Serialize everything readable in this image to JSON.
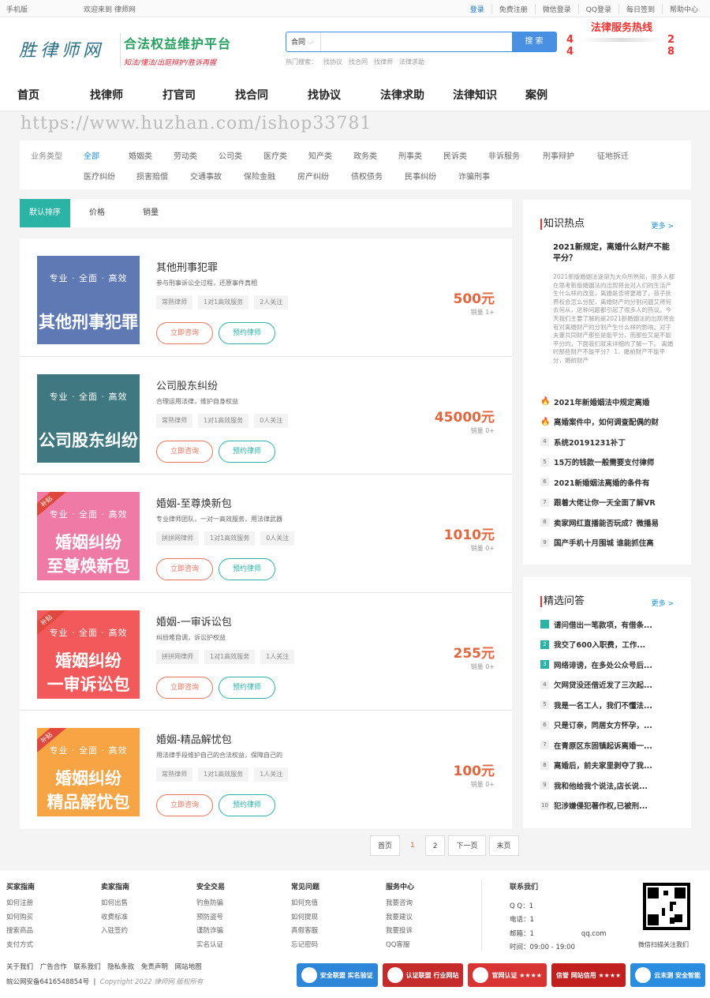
{
  "topbar": {
    "mobile": "手机版",
    "welcome": "欢迎来到 律师网",
    "links": [
      "登录",
      "免费注册",
      "微信登录",
      "QQ登录",
      "每日签到",
      "帮助中心"
    ]
  },
  "header": {
    "logo": "胜律师网",
    "slogan": "合法权益维护平台",
    "slogan_sub": "知法/懂法/出庭辩护/胜诉再握",
    "search": {
      "type": "合同",
      "button": "搜 索",
      "hot_label": "热门搜索：",
      "hot": [
        "找协议",
        "找合同",
        "找律师",
        "法律求助"
      ]
    },
    "hotline": {
      "title": "法律服务热线",
      "line1_left": "4",
      "line1_right": "2",
      "line2_left": "4",
      "line2_right": "8"
    }
  },
  "nav": [
    "首页",
    "找律师",
    "打官司",
    "找合同",
    "找协议",
    "法律求助",
    "法律知识",
    "案例"
  ],
  "watermark": "https://www.huzhan.com/ishop33781",
  "filter": {
    "label": "业务类型",
    "row1": [
      "全部",
      "婚姻类",
      "劳动类",
      "公司类",
      "医疗类",
      "知产类",
      "政务类",
      "刑事类",
      "民诉类",
      "非诉服务",
      "刑事辩护",
      "征地拆迁"
    ],
    "row2": [
      "医疗纠纷",
      "损害赔偿",
      "交通事故",
      "保险金融",
      "房产纠纷",
      "债权债务",
      "民事纠纷",
      "诈骗刑事"
    ]
  },
  "sort": [
    "默认排序",
    "价格",
    "销量"
  ],
  "items": [
    {
      "img_sub": "专业 · 全面 · 高效",
      "img_l1": "其他刑事犯罪",
      "img_l2": "",
      "title": "其他刑事犯罪",
      "desc": "参与刑事诉讼全过程，还原事件真相",
      "tags": [
        "常熟律师",
        "1对1高效服务",
        "2人关注"
      ],
      "price": "500元",
      "sales": "销量 1+",
      "consult": "立即咨询",
      "book": "预约律师",
      "color": "#5e79b4",
      "badge": ""
    },
    {
      "img_sub": "专业 · 全面 · 高效",
      "img_l1": "公司股东纠纷",
      "img_l2": "",
      "title": "公司股东纠纷",
      "desc": "合理运用法律，维护自身权益",
      "tags": [
        "常熟律师",
        "1对1高效服务",
        "0人关注"
      ],
      "price": "45000元",
      "sales": "销量 0+",
      "consult": "立即咨询",
      "book": "预约律师",
      "color": "#3f7880",
      "badge": ""
    },
    {
      "img_sub": "专业 · 全面 · 高效",
      "img_l1": "婚姻纠纷",
      "img_l2": "至尊焕新包",
      "title": "婚姻-至尊焕新包",
      "desc": "专业律师团队，一对一高效服务，用法律武器",
      "tags": [
        "拼拼网律师",
        "1对1高效服务",
        "0人关注"
      ],
      "price": "1010元",
      "sales": "销量 0+",
      "consult": "立即咨询",
      "book": "预约律师",
      "color": "#f07aa6",
      "badge": "补贴"
    },
    {
      "img_sub": "专业 · 全面 · 高效",
      "img_l1": "婚姻纠纷",
      "img_l2": "一审诉讼包",
      "title": "婚姻-一审诉讼包",
      "desc": "纠纷难自调，诉讼护权益",
      "tags": [
        "拼拼网律师",
        "1对1高效服务",
        "1人关注"
      ],
      "price": "255元",
      "sales": "销量 0+",
      "consult": "立即咨询",
      "book": "预约律师",
      "color": "#f2595a",
      "badge": "补贴"
    },
    {
      "img_sub": "专业 · 全面 · 高效",
      "img_l1": "婚姻纠纷",
      "img_l2": "精品解忧包",
      "title": "婚姻-精品解忧包",
      "desc": "用法律手段维护自己的合法权益，保障自己的",
      "tags": [
        "常熟律师",
        "1对1高效服务",
        "1人关注"
      ],
      "price": "100元",
      "sales": "销量 0+",
      "consult": "立即咨询",
      "book": "预约律师",
      "color": "#f7a445",
      "badge": "补贴"
    }
  ],
  "pager": [
    "首页",
    "1",
    "2",
    "下一页",
    "末页"
  ],
  "knowledge": {
    "title": "知识热点",
    "more": "更多 >",
    "top_title": "2021新规定，离婚什么财产不能平分？",
    "top_para": "2021新版婚姻法逐渐为大众所熟知，很多人都在思考新版婚姻法的出现将会对人们的生活产生什么样的改变，离婚是否将更难了，孩子抚养权会怎么分配，离婚财产的分割问题又将何去何从，这种问题都引起了很多人的热议。今天我们主要了解的是2021新婚姻法的出现将会有对离婚财产的分割产生什么样的影响。对于夫妻共同财产那些是能平分，而那些又是不能平分的，下面我们就来详细的了解一下。  离婚时那些财产不能平分？  1、婚前财产不能平分，婚前财产",
    "list": [
      "2021年新婚姻法中规定离婚",
      "离婚案件中，如何调查配偶的财",
      "系统20191231补丁",
      "15万的钱款一般需要支付律师",
      "2021新婚姻法离婚的条件有",
      "跟着大佬让你一天全面了解VR",
      "卖家网红直播能否玩成？微播易",
      "国产手机十月围城 谁能抓住高"
    ],
    "nums": [
      "",
      "",
      "4",
      "5",
      "6",
      "7",
      "8",
      "9"
    ]
  },
  "qa": {
    "title": "精选问答",
    "more": "更多 >",
    "list": [
      "请问借出一笔款项，有借条...",
      "我交了600入职费，工作...",
      "网络诽谤，在多处公众号后...",
      "欠网贷没还借近发了三次起...",
      "我是一名工人，我们不懂法...",
      "只是订亲，同居女方怀孕，...",
      "在青原区东固镇起诉离婚一...",
      "离婚后，前夫家里剥夺了我...",
      "我和他给我个说法,店长说...",
      "犯涉嫌侵犯著作权,已被刑..."
    ],
    "nums": [
      "",
      "2",
      "3",
      "4",
      "5",
      "6",
      "7",
      "8",
      "9",
      "10"
    ]
  },
  "footer": {
    "cols": [
      {
        "h": "买家指南",
        "l": [
          "如何注册",
          "如何购买",
          "搜索商品",
          "支付方式"
        ]
      },
      {
        "h": "卖家指南",
        "l": [
          "如何出售",
          "收费标准",
          "入驻签约"
        ]
      },
      {
        "h": "安全交易",
        "l": [
          "钓鱼防骗",
          "预防盗号",
          "谨防诈骗",
          "实名认证"
        ]
      },
      {
        "h": "常见问题",
        "l": [
          "如何充值",
          "如何提现",
          "真假客服",
          "忘记密码"
        ]
      },
      {
        "h": "服务中心",
        "l": [
          "我要咨询",
          "我要建议",
          "我要投诉",
          "QQ客服"
        ]
      }
    ],
    "contact": {
      "h": "联系我们",
      "qq": "Q Q：1",
      "tel": "电话：1",
      "mail": "邮箱：1",
      "mail_tail": "qq.com",
      "time": "时间：09:00 - 19:00"
    },
    "qr_caption": "微信扫描关注我们",
    "links": [
      "关于我们",
      "广告合作",
      "联系我们",
      "隐私条款",
      "免责声明",
      "网站地图"
    ],
    "icp": "皖公网安备6416548854号",
    "copyright": "Copyright 2022 律师网 版权所有",
    "badges": [
      {
        "text": "安全联盟 实名验证",
        "color": "#2d86d8"
      },
      {
        "text": "认证联盟 行业网站",
        "color": "#c62b2b"
      },
      {
        "text": "官网认证 ★★★★",
        "color": "#d93434"
      },
      {
        "text": "信誉 网站信用 ★★★★",
        "color": "#c21f1f"
      },
      {
        "text": "云末测 安全智能",
        "color": "#2a8de0"
      }
    ]
  },
  "colors": {
    "accent": "#2bb3a5",
    "price": "#e0663f",
    "link": "#1b8fd6"
  }
}
